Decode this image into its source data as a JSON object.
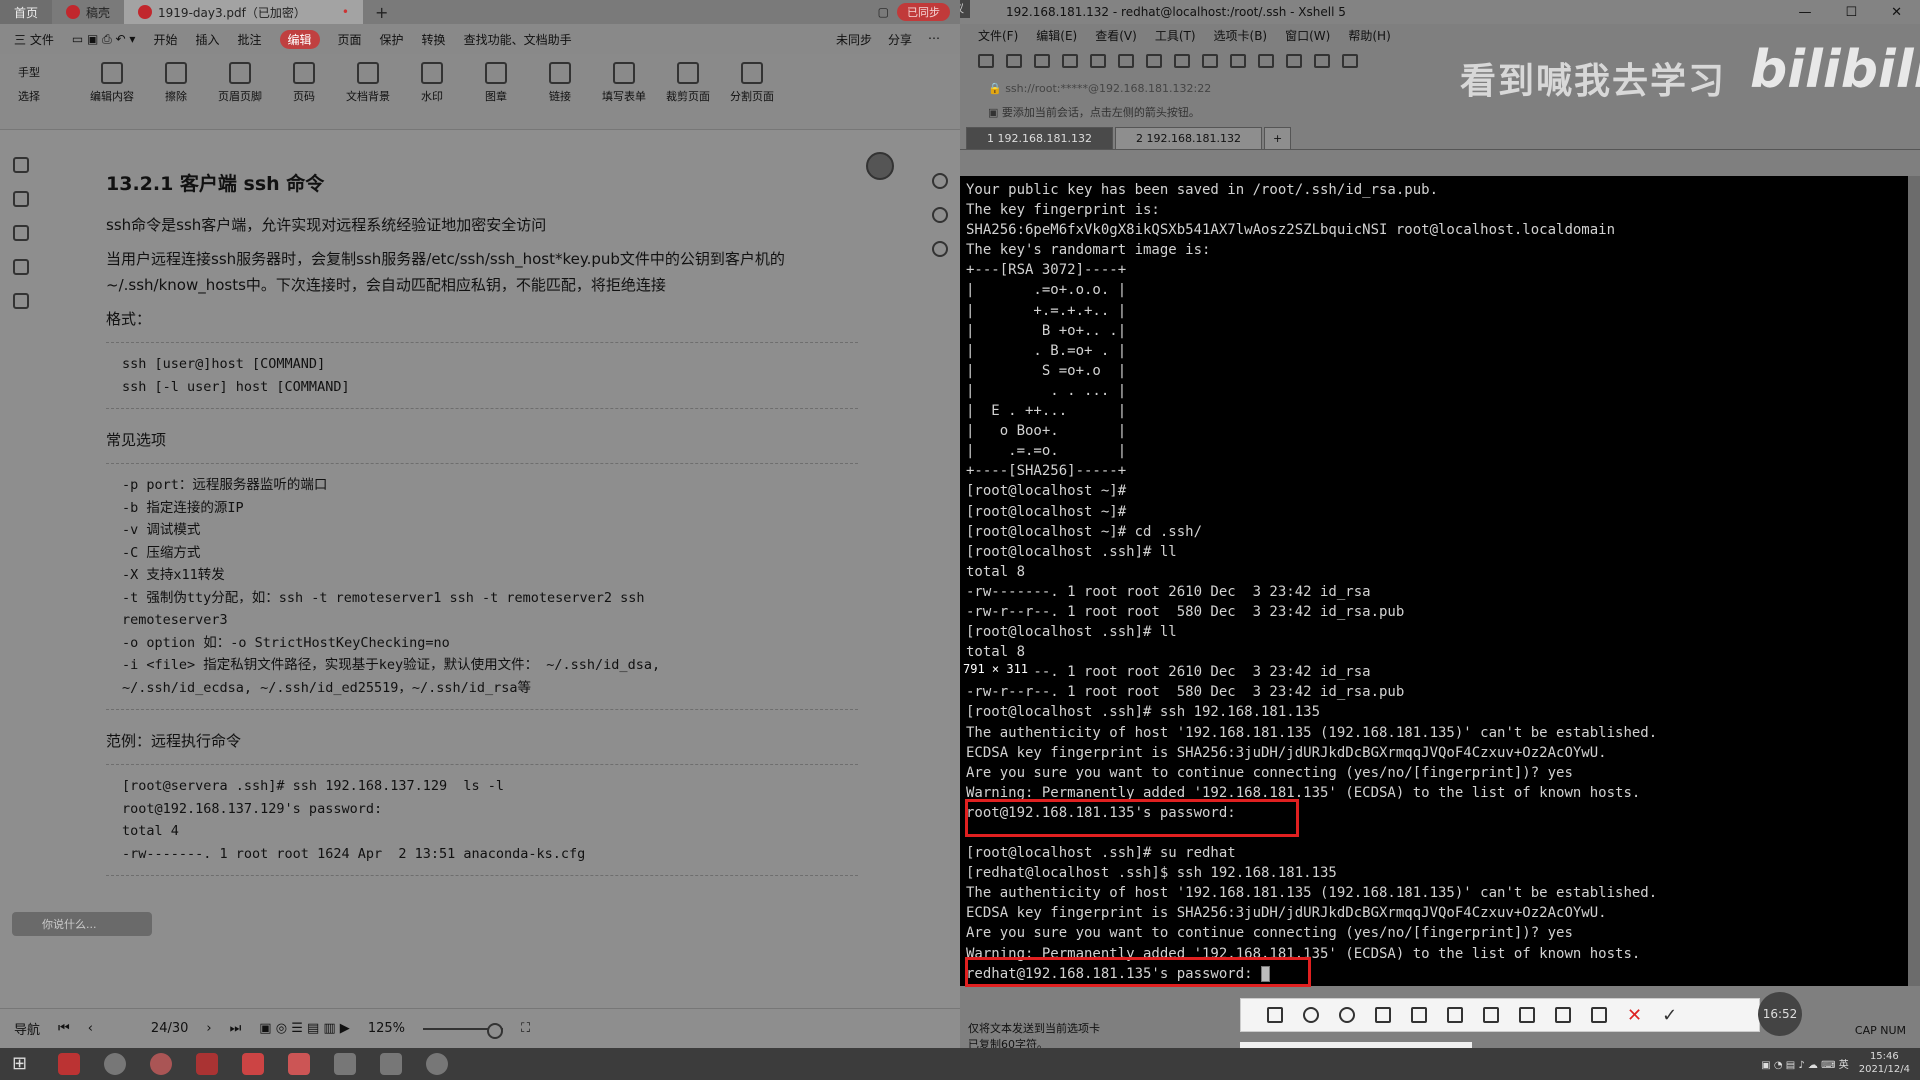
{
  "pdf": {
    "tabs": [
      {
        "label": "首页"
      },
      {
        "label": "稿壳"
      },
      {
        "label": "1919-day3.pdf（已加密）"
      }
    ],
    "add_tab": "+",
    "sync_label": "已同步",
    "menu": [
      "三 文件",
      "开始",
      "插入",
      "批注",
      "编辑",
      "页面",
      "保护",
      "转换",
      "查找功能、文档助手"
    ],
    "menu_highlight_index": 4,
    "unsync": "未同步",
    "share": "分享",
    "side_tools": [
      "手型",
      "选择"
    ],
    "tools": [
      "编辑内容",
      "擦除",
      "页眉页脚",
      "页码",
      "文档背景",
      "水印",
      "图章",
      "链接",
      "填写表单",
      "裁剪页面",
      "分割页面"
    ],
    "heading": "13.2.1 客户端 ssh 命令",
    "para1": "ssh命令是ssh客户端，允许实现对远程系统经验证地加密安全访问",
    "para2": "当用户远程连接ssh服务器时，会复制ssh服务器/etc/ssh/ssh_host*key.pub文件中的公钥到客户机的~/.ssh/know_hosts中。下次连接时，会自动匹配相应私钥，不能匹配，将拒绝连接",
    "format_label": "格式：",
    "format_code": "ssh [user@]host [COMMAND]\nssh [-l user] host [COMMAND]",
    "options_label": "常见选项",
    "options_code": "-p port：远程服务器监听的端口\n-b 指定连接的源IP\n-v 调试模式\n-C 压缩方式\n-X 支持x11转发\n-t 强制伪tty分配，如：ssh -t remoteserver1 ssh -t remoteserver2 ssh\nremoteserver3\n-o option 如：-o StrictHostKeyChecking=no\n-i <file> 指定私钥文件路径，实现基于key验证，默认使用文件： ~/.ssh/id_dsa,\n~/.ssh/id_ecdsa, ~/.ssh/id_ed25519，~/.ssh/id_rsa等",
    "example_label": "范例：远程执行命令",
    "example_code": "[root@servera .ssh]# ssh 192.168.137.129  ls -l\nroot@192.168.137.129's password:\ntotal 4\n-rw-------. 1 root root 1624 Apr  2 13:51 anaconda-ks.cfg",
    "floater": "你说什么...",
    "status": {
      "nav": "导航",
      "page": "24/30",
      "zoom": "125%"
    }
  },
  "xshell": {
    "meeting": "腾讯会议",
    "title": "192.168.181.132 - redhat@localhost:/root/.ssh - Xshell 5",
    "menu": [
      "文件(F)",
      "编辑(E)",
      "查看(V)",
      "工具(T)",
      "选项卡(B)",
      "窗口(W)",
      "帮助(H)"
    ],
    "address": "ssh://root:*****@192.168.181.132:22",
    "hint": "要添加当前会话，点击左侧的箭头按钮。",
    "tabs": [
      "1 192.168.181.132",
      "2 192.168.181.132"
    ],
    "add_tab": "+",
    "watermark": "看到喊我去学习",
    "brand": "bilibili",
    "size_tip": "791 × 311",
    "terminal_lines": [
      "Your public key has been saved in /root/.ssh/id_rsa.pub.",
      "The key fingerprint is:",
      "SHA256:6peM6fxVk0gX8ikQSXb541AX7lwAosz2SZLbquicNSI root@localhost.localdomain",
      "The key's randomart image is:",
      "+---[RSA 3072]----+",
      "|       .=o+.o.o. |",
      "|       +.=.+.+.. |",
      "|        B +o+.. .|",
      "|       . B.=o+ . |",
      "|        S =o+.o  |",
      "|         . . ... |",
      "|  E . ++...      |",
      "|   o Boo+.       |",
      "|    .=.=o.       |",
      "+----[SHA256]-----+",
      "[root@localhost ~]#",
      "[root@localhost ~]#",
      "[root@localhost ~]# cd .ssh/",
      "[root@localhost .ssh]# ll",
      "total 8",
      "-rw-------. 1 root root 2610 Dec  3 23:42 id_rsa",
      "-rw-r--r--. 1 root root  580 Dec  3 23:42 id_rsa.pub",
      "[root@localhost .ssh]# ll",
      "total 8",
      "-rw-------. 1 root root 2610 Dec  3 23:42 id_rsa",
      "-rw-r--r--. 1 root root  580 Dec  3 23:42 id_rsa.pub",
      "[root@localhost .ssh]# ssh 192.168.181.135",
      "The authenticity of host '192.168.181.135 (192.168.181.135)' can't be established.",
      "ECDSA key fingerprint is SHA256:3juDH/jdURJkdDcBGXrmqqJVQoF4Czxuv+Oz2AcOYwU.",
      "Are you sure you want to continue connecting (yes/no/[fingerprint])? yes",
      "Warning: Permanently added '192.168.181.135' (ECDSA) to the list of known hosts.",
      "root@192.168.181.135's password:",
      "",
      "[root@localhost .ssh]# su redhat",
      "[redhat@localhost .ssh]$ ssh 192.168.181.135",
      "The authenticity of host '192.168.181.135 (192.168.181.135)' can't be established.",
      "ECDSA key fingerprint is SHA256:3juDH/jdURJkdDcBGXrmqqJVQoF4Czxuv+Oz2AcOYwU.",
      "Are you sure you want to continue connecting (yes/no/[fingerprint])? yes",
      "Warning: Permanently added '192.168.181.135' (ECDSA) to the list of known hosts."
    ],
    "prompt_line": "redhat@192.168.181.135's password: ",
    "status_left": "已复制60字符。",
    "status_right": "CAP  NUM",
    "status_hint": "仅将文本发送到当前选项卡",
    "clock_badge": "16:52",
    "highlight_color": "#e02020"
  },
  "taskbar": {
    "time": "15:46",
    "date": "2021/12/4"
  }
}
